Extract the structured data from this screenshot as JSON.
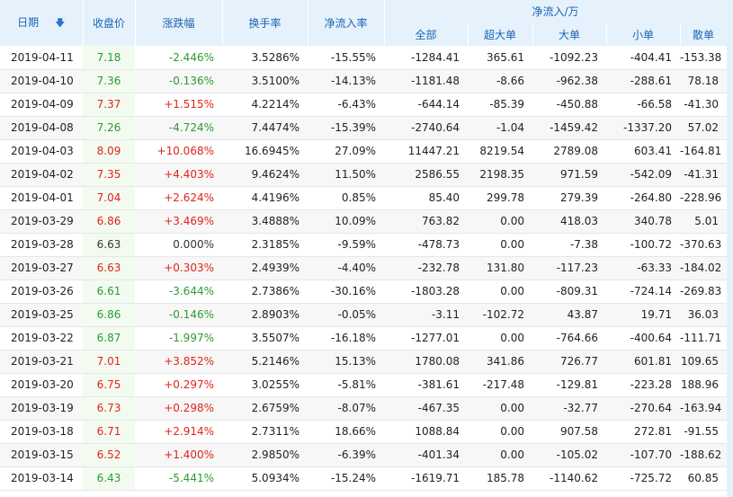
{
  "colors": {
    "header_bg": "#e6f2fb",
    "header_text": "#1a64b6",
    "up": "#e0241a",
    "down": "#2b9b32",
    "close_col_bg": "#f3fbf1"
  },
  "header": {
    "date": "日期",
    "sort_icon": "arrow-down-icon",
    "close": "收盘价",
    "change": "涨跌幅",
    "turnover": "换手率",
    "net_rate": "净流入率",
    "net_group": "净流入/万",
    "all": "全部",
    "super_large": "超大单",
    "large": "大单",
    "small": "小单",
    "retail": "散单"
  },
  "rows": [
    {
      "date": "2019-04-11",
      "close": "7.18",
      "change": "-2.446%",
      "turnover": "3.5286%",
      "net_rate": "-15.55%",
      "all": "-1284.41",
      "super_large": "365.61",
      "large": "-1092.23",
      "small": "-404.41",
      "retail": "-153.38",
      "dir": "down"
    },
    {
      "date": "2019-04-10",
      "close": "7.36",
      "change": "-0.136%",
      "turnover": "3.5100%",
      "net_rate": "-14.13%",
      "all": "-1181.48",
      "super_large": "-8.66",
      "large": "-962.38",
      "small": "-288.61",
      "retail": "78.18",
      "dir": "down"
    },
    {
      "date": "2019-04-09",
      "close": "7.37",
      "change": "+1.515%",
      "turnover": "4.2214%",
      "net_rate": "-6.43%",
      "all": "-644.14",
      "super_large": "-85.39",
      "large": "-450.88",
      "small": "-66.58",
      "retail": "-41.30",
      "dir": "up"
    },
    {
      "date": "2019-04-08",
      "close": "7.26",
      "change": "-4.724%",
      "turnover": "7.4474%",
      "net_rate": "-15.39%",
      "all": "-2740.64",
      "super_large": "-1.04",
      "large": "-1459.42",
      "small": "-1337.20",
      "retail": "57.02",
      "dir": "down"
    },
    {
      "date": "2019-04-03",
      "close": "8.09",
      "change": "+10.068%",
      "turnover": "16.6945%",
      "net_rate": "27.09%",
      "all": "11447.21",
      "super_large": "8219.54",
      "large": "2789.08",
      "small": "603.41",
      "retail": "-164.81",
      "dir": "up"
    },
    {
      "date": "2019-04-02",
      "close": "7.35",
      "change": "+4.403%",
      "turnover": "9.4624%",
      "net_rate": "11.50%",
      "all": "2586.55",
      "super_large": "2198.35",
      "large": "971.59",
      "small": "-542.09",
      "retail": "-41.31",
      "dir": "up"
    },
    {
      "date": "2019-04-01",
      "close": "7.04",
      "change": "+2.624%",
      "turnover": "4.4196%",
      "net_rate": "0.85%",
      "all": "85.40",
      "super_large": "299.78",
      "large": "279.39",
      "small": "-264.80",
      "retail": "-228.96",
      "dir": "up"
    },
    {
      "date": "2019-03-29",
      "close": "6.86",
      "change": "+3.469%",
      "turnover": "3.4888%",
      "net_rate": "10.09%",
      "all": "763.82",
      "super_large": "0.00",
      "large": "418.03",
      "small": "340.78",
      "retail": "5.01",
      "dir": "up"
    },
    {
      "date": "2019-03-28",
      "close": "6.63",
      "change": "0.000%",
      "turnover": "2.3185%",
      "net_rate": "-9.59%",
      "all": "-478.73",
      "super_large": "0.00",
      "large": "-7.38",
      "small": "-100.72",
      "retail": "-370.63",
      "dir": "flat"
    },
    {
      "date": "2019-03-27",
      "close": "6.63",
      "change": "+0.303%",
      "turnover": "2.4939%",
      "net_rate": "-4.40%",
      "all": "-232.78",
      "super_large": "131.80",
      "large": "-117.23",
      "small": "-63.33",
      "retail": "-184.02",
      "dir": "up"
    },
    {
      "date": "2019-03-26",
      "close": "6.61",
      "change": "-3.644%",
      "turnover": "2.7386%",
      "net_rate": "-30.16%",
      "all": "-1803.28",
      "super_large": "0.00",
      "large": "-809.31",
      "small": "-724.14",
      "retail": "-269.83",
      "dir": "down"
    },
    {
      "date": "2019-03-25",
      "close": "6.86",
      "change": "-0.146%",
      "turnover": "2.8903%",
      "net_rate": "-0.05%",
      "all": "-3.11",
      "super_large": "-102.72",
      "large": "43.87",
      "small": "19.71",
      "retail": "36.03",
      "dir": "down"
    },
    {
      "date": "2019-03-22",
      "close": "6.87",
      "change": "-1.997%",
      "turnover": "3.5507%",
      "net_rate": "-16.18%",
      "all": "-1277.01",
      "super_large": "0.00",
      "large": "-764.66",
      "small": "-400.64",
      "retail": "-111.71",
      "dir": "down"
    },
    {
      "date": "2019-03-21",
      "close": "7.01",
      "change": "+3.852%",
      "turnover": "5.2146%",
      "net_rate": "15.13%",
      "all": "1780.08",
      "super_large": "341.86",
      "large": "726.77",
      "small": "601.81",
      "retail": "109.65",
      "dir": "up"
    },
    {
      "date": "2019-03-20",
      "close": "6.75",
      "change": "+0.297%",
      "turnover": "3.0255%",
      "net_rate": "-5.81%",
      "all": "-381.61",
      "super_large": "-217.48",
      "large": "-129.81",
      "small": "-223.28",
      "retail": "188.96",
      "dir": "up"
    },
    {
      "date": "2019-03-19",
      "close": "6.73",
      "change": "+0.298%",
      "turnover": "2.6759%",
      "net_rate": "-8.07%",
      "all": "-467.35",
      "super_large": "0.00",
      "large": "-32.77",
      "small": "-270.64",
      "retail": "-163.94",
      "dir": "up"
    },
    {
      "date": "2019-03-18",
      "close": "6.71",
      "change": "+2.914%",
      "turnover": "2.7311%",
      "net_rate": "18.66%",
      "all": "1088.84",
      "super_large": "0.00",
      "large": "907.58",
      "small": "272.81",
      "retail": "-91.55",
      "dir": "up"
    },
    {
      "date": "2019-03-15",
      "close": "6.52",
      "change": "+1.400%",
      "turnover": "2.9850%",
      "net_rate": "-6.39%",
      "all": "-401.34",
      "super_large": "0.00",
      "large": "-105.02",
      "small": "-107.70",
      "retail": "-188.62",
      "dir": "up"
    },
    {
      "date": "2019-03-14",
      "close": "6.43",
      "change": "-5.441%",
      "turnover": "5.0934%",
      "net_rate": "-15.24%",
      "all": "-1619.71",
      "super_large": "185.78",
      "large": "-1140.62",
      "small": "-725.72",
      "retail": "60.85",
      "dir": "down"
    }
  ]
}
